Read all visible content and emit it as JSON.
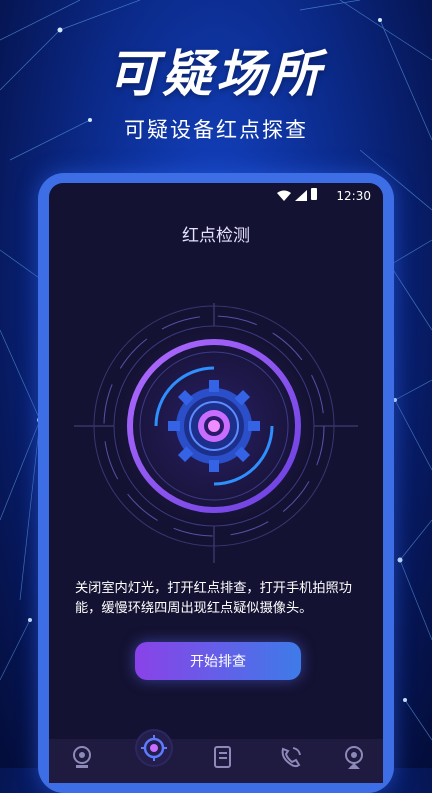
{
  "promo": {
    "title": "可疑场所",
    "subtitle": "可疑设备红点探查"
  },
  "status_bar": {
    "time": "12:30",
    "icons": [
      "wifi-icon",
      "signal-icon",
      "battery-icon"
    ]
  },
  "screen": {
    "title": "红点检测",
    "instruction": "关闭室内灯光，打开红点排查，打开手机拍照功能，缓慢环绕四周出现红点疑似摄像头。",
    "start_button": "开始排查"
  },
  "tab_bar": {
    "tabs": [
      {
        "icon": "camera-icon",
        "active": false
      },
      {
        "icon": "target-icon",
        "active": true
      },
      {
        "icon": "notebook-icon",
        "active": false
      },
      {
        "icon": "phone-call-icon",
        "active": false
      },
      {
        "icon": "webcam-icon",
        "active": false
      }
    ]
  },
  "colors": {
    "accent_purple": "#9b5cff",
    "accent_blue": "#3e7be8",
    "screen_bg": "#141232",
    "highlight_pink": "#e07bff"
  }
}
